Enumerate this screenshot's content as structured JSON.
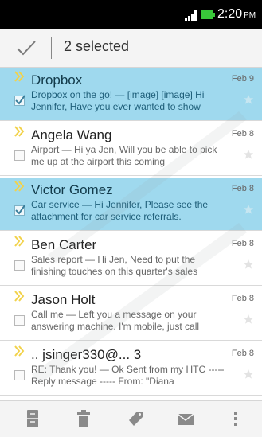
{
  "status_bar": {
    "time": "2:20",
    "ampm": "PM"
  },
  "action_bar": {
    "selected_label": "2 selected"
  },
  "messages": [
    {
      "sender": "Dropbox",
      "date": "Feb 9",
      "preview": "Dropbox on the go! — [image] [image] Hi Jennifer, Have you ever wanted to show",
      "selected": true,
      "checked": true
    },
    {
      "sender": "Angela Wang",
      "date": "Feb 8",
      "preview": "Airport — Hi ya Jen, Will you be able to pick me up at the airport this coming",
      "selected": false,
      "checked": false
    },
    {
      "sender": "Victor Gomez",
      "date": "Feb 8",
      "preview": "Car service — Hi Jennifer, Please see the attachment for car service referrals.",
      "selected": true,
      "checked": true
    },
    {
      "sender": "Ben Carter",
      "date": "Feb 8",
      "preview": "Sales report — Hi Jen, Need to put the finishing touches on this quarter's sales",
      "selected": false,
      "checked": false
    },
    {
      "sender": "Jason Holt",
      "date": "Feb 8",
      "preview": "Call me — Left you a message on your answering machine. I'm mobile, just call",
      "selected": false,
      "checked": false
    },
    {
      "sender": ".. jsinger330@... 3",
      "date": "Feb 8",
      "preview": "RE: Thank you! — Ok Sent from my HTC ----- Reply message ----- From: \"Diana",
      "selected": false,
      "checked": false
    }
  ],
  "bottom_bar": [
    "archive-icon",
    "trash-icon",
    "label-tag-icon",
    "move-mail-icon",
    "overflow-menu-icon"
  ],
  "colors": {
    "selected_row": "#9fd9ee",
    "unread_marker": "#f2d24b",
    "status_bar": "#000000"
  }
}
